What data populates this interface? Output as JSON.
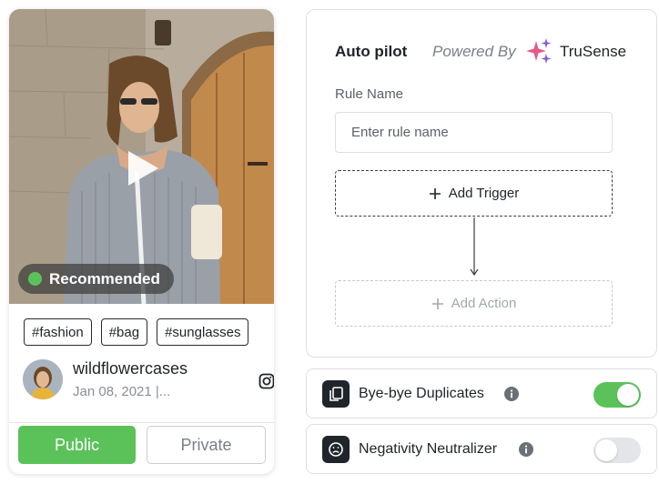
{
  "post": {
    "badge": "Recommended",
    "tags": [
      "#fashion",
      "#bag",
      "#sunglasses"
    ],
    "author": "wildflowercases",
    "date": "Jan 08, 2021 |...",
    "public_label": "Public",
    "private_label": "Private"
  },
  "autopilot": {
    "title": "Auto pilot",
    "powered_by": "Powered By",
    "brand": "TruSense",
    "rule_name_label": "Rule Name",
    "rule_name_placeholder": "Enter rule name",
    "add_trigger": "Add Trigger",
    "add_action": "Add Action"
  },
  "features": [
    {
      "label": "Bye-bye Duplicates",
      "enabled": true
    },
    {
      "label": "Negativity Neutralizer",
      "enabled": false
    }
  ],
  "colors": {
    "accent_green": "#5bc25a",
    "dark": "#20252b",
    "border": "#dcdfe3",
    "brand_pink": "#e55b8a",
    "brand_purple": "#8a5bd6"
  }
}
